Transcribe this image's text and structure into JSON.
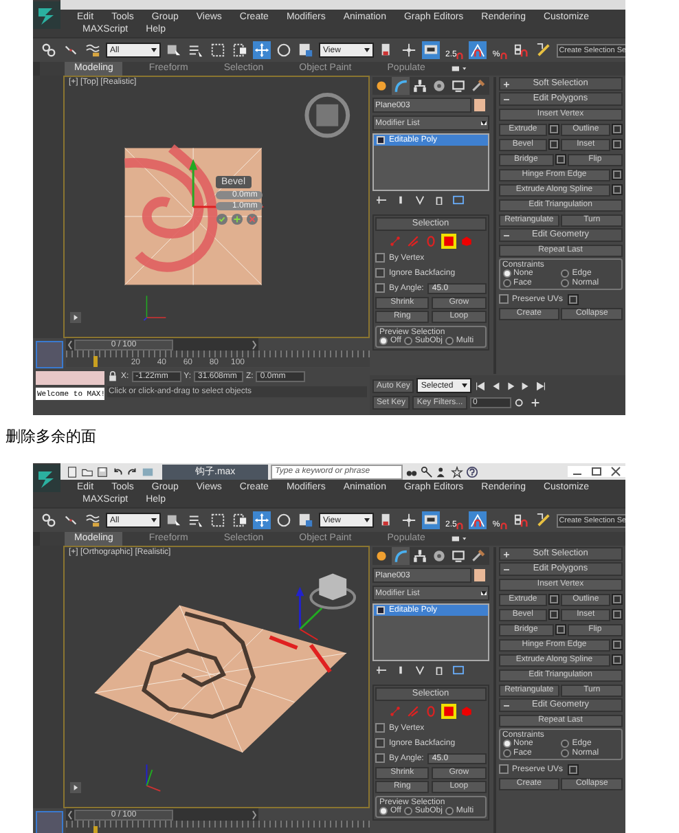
{
  "screenshots": [
    {
      "menu_rows": [
        [
          "Edit",
          "Tools",
          "Group",
          "Views",
          "Create",
          "Modifiers",
          "Animation",
          "Graph Editors",
          "Rendering",
          "Customize"
        ],
        [
          "MAXScript",
          "Help"
        ]
      ],
      "toolbar": [
        {
          "kind": "link",
          "on": false
        },
        {
          "kind": "unlink",
          "on": false
        },
        {
          "kind": "bind",
          "on": false
        },
        {
          "kind": "dropdown",
          "value": "All"
        },
        {
          "kind": "select",
          "on": false
        },
        {
          "kind": "select-name",
          "on": false
        },
        {
          "kind": "rect-region",
          "on": false
        },
        {
          "kind": "window-crossing",
          "on": false
        },
        {
          "kind": "move",
          "on": true
        },
        {
          "kind": "rotate",
          "on": false
        },
        {
          "kind": "scale",
          "on": false
        },
        {
          "kind": "dropdown",
          "value": "View"
        },
        {
          "kind": "pivot",
          "on": false
        },
        {
          "kind": "axis",
          "on": false
        },
        {
          "kind": "keyboard",
          "on": true
        },
        {
          "kind": "snap",
          "label": "2.5",
          "on": false
        },
        {
          "kind": "angle-snap",
          "on": true
        },
        {
          "kind": "snap",
          "label": "%",
          "on": false
        },
        {
          "kind": "spinner-snap",
          "on": false
        },
        {
          "kind": "edit-named",
          "on": false
        },
        {
          "kind": "field",
          "value": "Create Selection Se"
        }
      ],
      "ribbon_tabs": [
        {
          "label": "Modeling",
          "selected": true
        },
        {
          "label": "Freeform",
          "selected": false
        },
        {
          "label": "Selection",
          "selected": false
        },
        {
          "label": "Object Paint",
          "selected": false
        },
        {
          "label": "Populate",
          "selected": false
        }
      ],
      "viewport": {
        "label": "[+] [Top] [Realistic]",
        "kind": "top",
        "caddy": {
          "title": "Bevel",
          "fields": [
            "0.0mm",
            "1.0mm"
          ]
        }
      },
      "command_panel": {
        "object_name": "Plane003",
        "modifier_list": "Modifier List",
        "stack": [
          {
            "label": "Editable Poly",
            "selected": true
          }
        ],
        "selection": {
          "title": "Selection",
          "subobjects": [
            {
              "kind": "vertex",
              "selected": false
            },
            {
              "kind": "edge",
              "selected": false
            },
            {
              "kind": "border",
              "selected": false
            },
            {
              "kind": "polygon",
              "selected": true
            },
            {
              "kind": "element",
              "selected": false
            }
          ],
          "options": [
            {
              "label": "By Vertex",
              "checked": false
            },
            {
              "label": "Ignore Backfacing",
              "checked": false
            },
            {
              "label": "By Angle:",
              "checked": false,
              "value": "45.0"
            }
          ],
          "buttons": [
            "Shrink",
            "Grow",
            "Ring",
            "Loop"
          ],
          "preview": {
            "title": "Preview Selection",
            "options": [
              {
                "label": "Off",
                "selected": true
              },
              {
                "label": "SubObj",
                "selected": false
              },
              {
                "label": "Multi",
                "selected": false
              }
            ]
          }
        },
        "soft_selection": {
          "title": "Soft Selection",
          "expanded": false
        },
        "edit_polygons": {
          "title": "Edit Polygons",
          "expanded": true,
          "rows": [
            [
              {
                "label": "Insert Vertex",
                "settings": false
              }
            ],
            [
              {
                "label": "Extrude",
                "settings": true
              },
              {
                "label": "Outline",
                "settings": true
              }
            ],
            [
              {
                "label": "Bevel",
                "settings": true
              },
              {
                "label": "Inset",
                "settings": true
              }
            ],
            [
              {
                "label": "Bridge",
                "settings": true
              },
              {
                "label": "Flip",
                "settings": false
              }
            ],
            [
              {
                "label": "Hinge From Edge",
                "settings": true
              }
            ],
            [
              {
                "label": "Extrude Along Spline",
                "settings": true
              }
            ],
            [
              {
                "label": "Edit Triangulation",
                "settings": false
              }
            ],
            [
              {
                "label": "Retriangulate",
                "settings": false
              },
              {
                "label": "Turn",
                "settings": false
              }
            ]
          ]
        },
        "edit_geometry": {
          "title": "Edit Geometry",
          "expanded": true,
          "repeat": "Repeat Last",
          "constraints": {
            "title": "Constraints",
            "options": [
              {
                "label": "None",
                "selected": true
              },
              {
                "label": "Edge",
                "selected": false
              },
              {
                "label": "Face",
                "selected": false
              },
              {
                "label": "Normal",
                "selected": false
              }
            ]
          },
          "preserve_uvs": {
            "label": "Preserve UVs",
            "checked": false
          },
          "buttons": [
            "Create",
            "Collapse"
          ]
        }
      },
      "timeline": {
        "position": "0 / 100",
        "ticks": [
          "20",
          "40",
          "60",
          "80",
          "100"
        ]
      },
      "status": {
        "welcome": "Welcome to MAX!",
        "prompt": "Click or click-and-drag to select objects",
        "coords": [
          {
            "label": "X:",
            "value": "-1.22mm"
          },
          {
            "label": "Y:",
            "value": "31.608mm"
          },
          {
            "label": "Z:",
            "value": "0.0mm"
          }
        ]
      },
      "anim": {
        "auto_key": "Auto Key",
        "key_mode": "Selected",
        "set_key": "Set Key",
        "key_filters": "Key Filters...",
        "frame": "0"
      }
    },
    {
      "title_bar": {
        "file": "钩子.max",
        "search_placeholder": "Type a keyword or phrase"
      },
      "menu_rows": [
        [
          "Edit",
          "Tools",
          "Group",
          "Views",
          "Create",
          "Modifiers",
          "Animation",
          "Graph Editors",
          "Rendering",
          "Customize"
        ],
        [
          "MAXScript",
          "Help"
        ]
      ],
      "toolbar": [
        {
          "kind": "link",
          "on": false
        },
        {
          "kind": "unlink",
          "on": false
        },
        {
          "kind": "bind",
          "on": false
        },
        {
          "kind": "dropdown",
          "value": "All"
        },
        {
          "kind": "select",
          "on": false
        },
        {
          "kind": "select-name",
          "on": false
        },
        {
          "kind": "rect-region",
          "on": false
        },
        {
          "kind": "window-crossing",
          "on": false
        },
        {
          "kind": "move",
          "on": true
        },
        {
          "kind": "rotate",
          "on": false
        },
        {
          "kind": "scale",
          "on": false
        },
        {
          "kind": "dropdown",
          "value": "View"
        },
        {
          "kind": "pivot",
          "on": false
        },
        {
          "kind": "axis",
          "on": false
        },
        {
          "kind": "keyboard",
          "on": true
        },
        {
          "kind": "snap",
          "label": "2.5",
          "on": false
        },
        {
          "kind": "angle-snap",
          "on": true
        },
        {
          "kind": "snap",
          "label": "%",
          "on": false
        },
        {
          "kind": "spinner-snap",
          "on": false
        },
        {
          "kind": "edit-named",
          "on": false
        },
        {
          "kind": "field",
          "value": "Create Selection Se"
        }
      ],
      "ribbon_tabs": [
        {
          "label": "Modeling",
          "selected": true
        },
        {
          "label": "Freeform",
          "selected": false
        },
        {
          "label": "Selection",
          "selected": false
        },
        {
          "label": "Object Paint",
          "selected": false
        },
        {
          "label": "Populate",
          "selected": false
        }
      ],
      "viewport": {
        "label": "[+] [Orthographic] [Realistic]",
        "kind": "perspective"
      },
      "command_panel": {
        "object_name": "Plane003",
        "modifier_list": "Modifier List",
        "stack": [
          {
            "label": "Editable Poly",
            "selected": true
          }
        ],
        "selection": {
          "title": "Selection",
          "subobjects": [
            {
              "kind": "vertex",
              "selected": false
            },
            {
              "kind": "edge",
              "selected": false
            },
            {
              "kind": "border",
              "selected": false
            },
            {
              "kind": "polygon",
              "selected": true
            },
            {
              "kind": "element",
              "selected": false
            }
          ],
          "options": [
            {
              "label": "By Vertex",
              "checked": false
            },
            {
              "label": "Ignore Backfacing",
              "checked": false
            },
            {
              "label": "By Angle:",
              "checked": false,
              "value": "45.0"
            }
          ],
          "buttons": [
            "Shrink",
            "Grow",
            "Ring",
            "Loop"
          ],
          "preview": {
            "title": "Preview Selection",
            "options": [
              {
                "label": "Off",
                "selected": true
              },
              {
                "label": "SubObj",
                "selected": false
              },
              {
                "label": "Multi",
                "selected": false
              }
            ]
          }
        },
        "soft_selection": {
          "title": "Soft Selection",
          "expanded": false
        },
        "edit_polygons": {
          "title": "Edit Polygons",
          "expanded": true,
          "rows": [
            [
              {
                "label": "Insert Vertex",
                "settings": false
              }
            ],
            [
              {
                "label": "Extrude",
                "settings": true
              },
              {
                "label": "Outline",
                "settings": true
              }
            ],
            [
              {
                "label": "Bevel",
                "settings": true
              },
              {
                "label": "Inset",
                "settings": true
              }
            ],
            [
              {
                "label": "Bridge",
                "settings": true
              },
              {
                "label": "Flip",
                "settings": false
              }
            ],
            [
              {
                "label": "Hinge From Edge",
                "settings": true
              }
            ],
            [
              {
                "label": "Extrude Along Spline",
                "settings": true
              }
            ],
            [
              {
                "label": "Edit Triangulation",
                "settings": false
              }
            ],
            [
              {
                "label": "Retriangulate",
                "settings": false
              },
              {
                "label": "Turn",
                "settings": false
              }
            ]
          ]
        },
        "edit_geometry": {
          "title": "Edit Geometry",
          "expanded": true,
          "repeat": "Repeat Last",
          "constraints": {
            "title": "Constraints",
            "options": [
              {
                "label": "None",
                "selected": true
              },
              {
                "label": "Edge",
                "selected": false
              },
              {
                "label": "Face",
                "selected": false
              },
              {
                "label": "Normal",
                "selected": false
              }
            ]
          },
          "preserve_uvs": {
            "label": "Preserve UVs",
            "checked": false
          },
          "buttons": [
            "Create",
            "Collapse"
          ]
        }
      },
      "timeline": {
        "position": "0 / 100"
      }
    }
  ],
  "caption": "删除多余的面"
}
